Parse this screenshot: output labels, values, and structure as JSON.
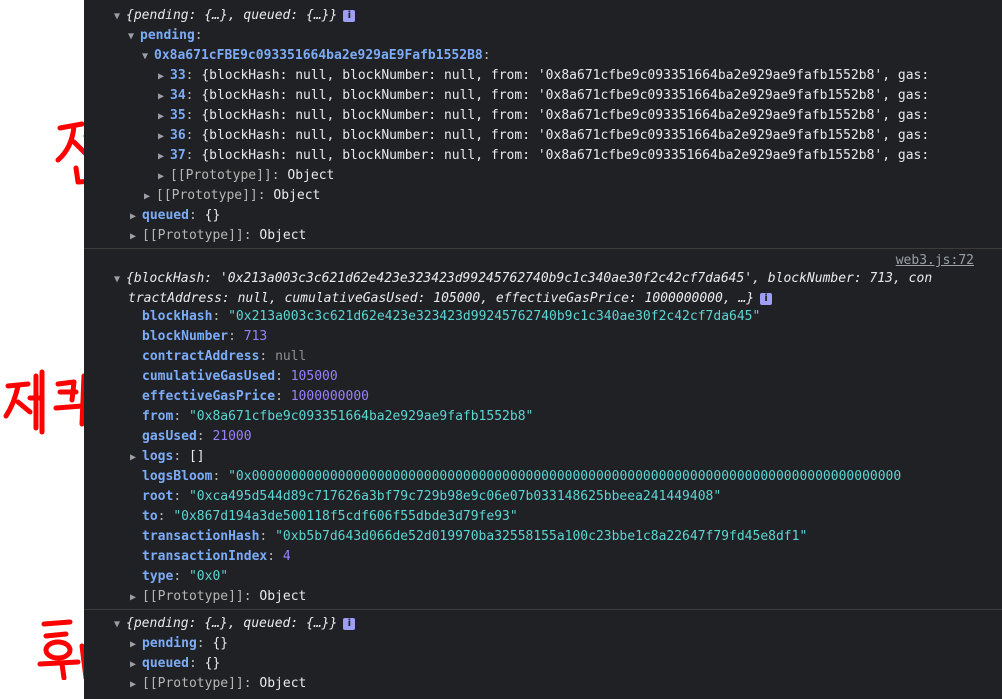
{
  "annotations": {
    "before": "전",
    "receipt": "체크",
    "after": "후"
  },
  "entry1": {
    "summary": "{pending: {…}, queued: {…}}",
    "pending_key": "pending",
    "address_key": "0x8a671cFBE9c093351664ba2e929aE9Fafb1552B8",
    "txs": [
      {
        "index": "33",
        "text": "{blockHash: null, blockNumber: null, from: '0x8a671cfbe9c093351664ba2e929ae9fafb1552b8', gas:"
      },
      {
        "index": "34",
        "text": "{blockHash: null, blockNumber: null, from: '0x8a671cfbe9c093351664ba2e929ae9fafb1552b8', gas:"
      },
      {
        "index": "35",
        "text": "{blockHash: null, blockNumber: null, from: '0x8a671cfbe9c093351664ba2e929ae9fafb1552b8', gas:"
      },
      {
        "index": "36",
        "text": "{blockHash: null, blockNumber: null, from: '0x8a671cfbe9c093351664ba2e929ae9fafb1552b8', gas:"
      },
      {
        "index": "37",
        "text": "{blockHash: null, blockNumber: null, from: '0x8a671cfbe9c093351664ba2e929ae9fafb1552b8', gas:"
      }
    ],
    "prototype_label": "[[Prototype]]",
    "object_label": "Object",
    "queued_key": "queued",
    "empty_obj": "{}"
  },
  "entry2": {
    "source_link": "web3.js:72",
    "summary_line1": "{blockHash: '0x213a003c3c621d62e423e323423d99245762740b9c1c340ae30f2c42cf7da645', blockNumber: 713, con",
    "summary_line2": "tractAddress: null, cumulativeGasUsed: 105000, effectiveGasPrice: 1000000000, …}",
    "props": [
      {
        "key": "blockHash",
        "value": "\"0x213a003c3c621d62e423e323423d99245762740b9c1c340ae30f2c42cf7da645\"",
        "type": "s"
      },
      {
        "key": "blockNumber",
        "value": "713",
        "type": "n"
      },
      {
        "key": "contractAddress",
        "value": "null",
        "type": "nul"
      },
      {
        "key": "cumulativeGasUsed",
        "value": "105000",
        "type": "n"
      },
      {
        "key": "effectiveGasPrice",
        "value": "1000000000",
        "type": "n"
      },
      {
        "key": "from",
        "value": "\"0x8a671cfbe9c093351664ba2e929ae9fafb1552b8\"",
        "type": "s"
      },
      {
        "key": "gasUsed",
        "value": "21000",
        "type": "n"
      }
    ],
    "logs_key": "logs",
    "logs_value": "[]",
    "props2": [
      {
        "key": "logsBloom",
        "value": "\"0x00000000000000000000000000000000000000000000000000000000000000000000000000000000000",
        "type": "s"
      },
      {
        "key": "root",
        "value": "\"0xca495d544d89c717626a3bf79c729b98e9c06e07b033148625bbeea241449408\"",
        "type": "s"
      },
      {
        "key": "to",
        "value": "\"0x867d194a3de500118f5cdf606f55dbde3d79fe93\"",
        "type": "s"
      },
      {
        "key": "transactionHash",
        "value": "\"0xb5b7d643d066de52d019970ba32558155a100c23bbe1c8a22647f79fd45e8df1\"",
        "type": "s"
      },
      {
        "key": "transactionIndex",
        "value": "4",
        "type": "n"
      },
      {
        "key": "type",
        "value": "\"0x0\"",
        "type": "s"
      }
    ],
    "prototype_label": "[[Prototype]]",
    "object_label": "Object"
  },
  "entry3": {
    "summary": "{pending: {…}, queued: {…}}",
    "pending_key": "pending",
    "queued_key": "queued",
    "empty_obj": "{}",
    "prototype_label": "[[Prototype]]",
    "object_label": "Object"
  },
  "colors": {
    "background": "#202124",
    "key": "#7cacf8",
    "string": "#5cd5d5",
    "number": "#9980ff",
    "annotation": "#ff0000"
  }
}
